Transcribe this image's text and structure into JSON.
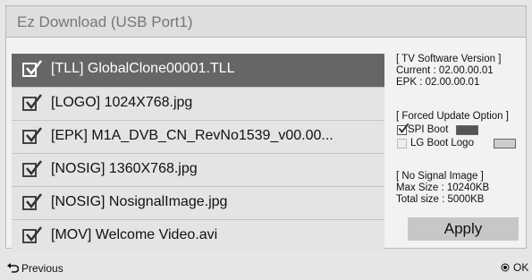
{
  "dialog": {
    "title": "Ez Download (USB Port1)"
  },
  "files": [
    {
      "name": "[TLL] GlobalClone00001.TLL",
      "checked": true,
      "selected": true
    },
    {
      "name": "[LOGO] 1024X768.jpg",
      "checked": true,
      "selected": false
    },
    {
      "name": "[EPK] M1A_DVB_CN_RevNo1539_v00.00...",
      "checked": true,
      "selected": false
    },
    {
      "name": "[NOSIG] 1360X768.jpg",
      "checked": true,
      "selected": false
    },
    {
      "name": "[NOSIG] NosignalImage.jpg",
      "checked": true,
      "selected": false
    },
    {
      "name": "[MOV] Welcome Video.avi",
      "checked": true,
      "selected": false
    }
  ],
  "software": {
    "heading": "[ TV Software Version ]",
    "current": "Current : 02.00.00.01",
    "epk": "EPK : 02.00.00.01"
  },
  "forced_update": {
    "heading": "[ Forced Update Option ]",
    "spi_boot": {
      "label": "SPI Boot",
      "checked": true,
      "swatch_color": "#555555"
    },
    "lg_boot_logo": {
      "label": "LG Boot Logo",
      "checked": false,
      "swatch_color": "#cccccc"
    }
  },
  "no_signal": {
    "heading": "[ No Signal Image ]",
    "max_size": "Max Size : 10240KB",
    "total_size": "Total size : 5000KB"
  },
  "apply_label": "Apply",
  "footer": {
    "previous_label": "Previous",
    "ok_label": "OK"
  },
  "icons": {
    "previous": "return-arrow-icon",
    "ok": "ok-dot-icon",
    "check": "checkmark-icon"
  }
}
